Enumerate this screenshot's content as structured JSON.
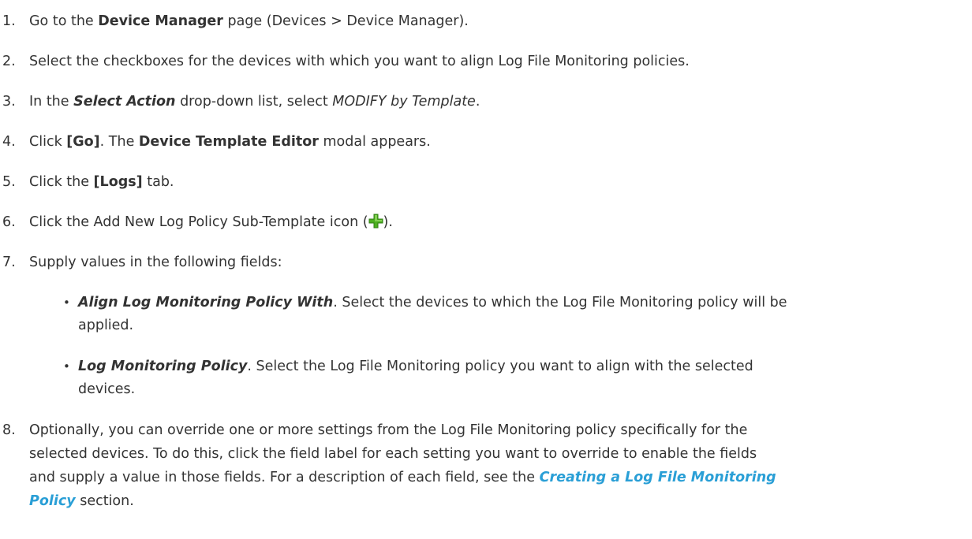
{
  "steps": [
    {
      "num": "1.",
      "a": "Go to the ",
      "b": "Device Manager",
      "c": " page (Devices > Device Manager)."
    },
    {
      "num": "2.",
      "a": "Select the checkboxes for the devices with which you want to align Log File Monitoring policies."
    },
    {
      "num": "3.",
      "a": "In the ",
      "b": "Select Action",
      "c": " drop-down list, select ",
      "d": "MODIFY by Template",
      "e": "."
    },
    {
      "num": "4.",
      "a": "Click ",
      "b": "[Go]",
      "c": ". The ",
      "d": "Device Template Editor",
      "e": " modal appears."
    },
    {
      "num": "5.",
      "a": "Click the ",
      "b": "[Logs]",
      "c": " tab."
    },
    {
      "num": "6.",
      "a": "Click the Add New Log Policy Sub-Template icon (",
      "icon": "green-plus-icon",
      "c": ")."
    },
    {
      "num": "7.",
      "a": "Supply values in the following fields:"
    },
    {
      "num": "8.",
      "a": "Optionally, you can override one or more settings from the Log File Monitoring policy specifically for the",
      "a2": "selected devices. To do this, click the field label for each setting you want to override to enable the fields",
      "a3": "and supply a value in those fields. For a description of each field, see the ",
      "link1": "Creating a Log File Monitoring",
      "link2": "Policy",
      "c": " section."
    }
  ],
  "bullets": [
    {
      "term": "Align Log Monitoring Policy With",
      "line1": ". Select the devices to which the Log File Monitoring policy will be",
      "line2": "applied."
    },
    {
      "term": "Log Monitoring Policy",
      "line1": ". Select the Log File Monitoring policy you want to align with the selected",
      "line2": "devices."
    }
  ],
  "colors": {
    "text": "#333333",
    "link": "#2a9fd6",
    "icon": "#4caf1f"
  }
}
